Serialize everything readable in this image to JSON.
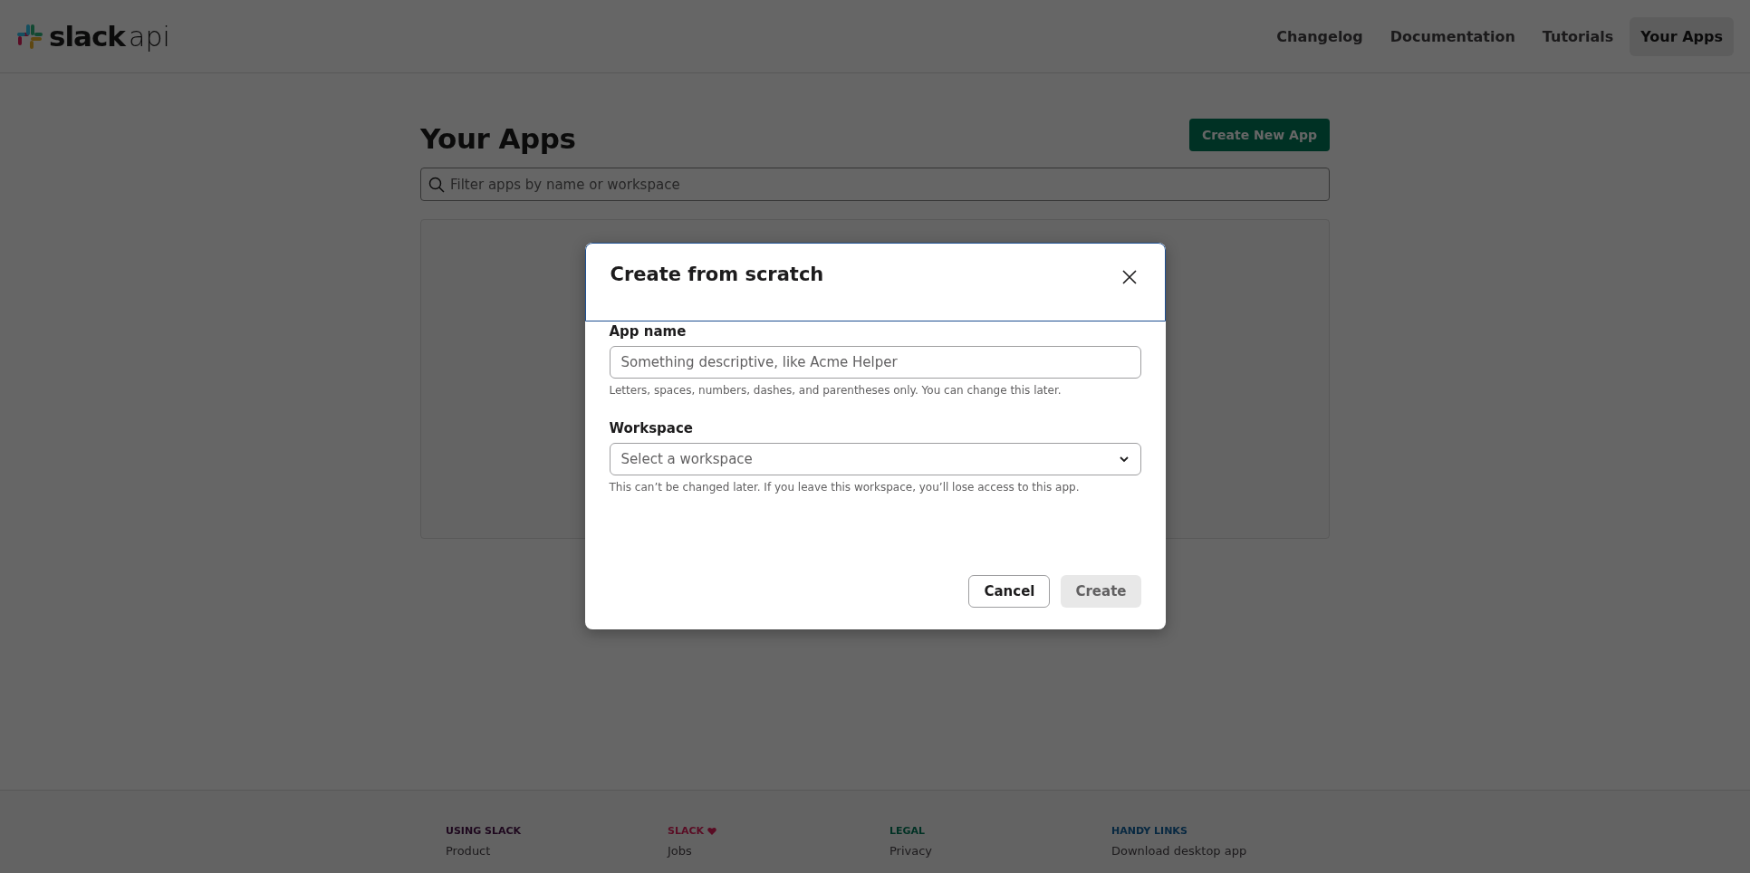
{
  "header": {
    "logo": {
      "word": "slack",
      "suffix": "api"
    },
    "nav": [
      {
        "label": "Changelog",
        "selected": false
      },
      {
        "label": "Documentation",
        "selected": false
      },
      {
        "label": "Tutorials",
        "selected": false
      },
      {
        "label": "Your Apps",
        "selected": true
      }
    ]
  },
  "page": {
    "title": "Your Apps",
    "create_button": "Create New App",
    "search": {
      "placeholder": "Filter apps by name or workspace"
    }
  },
  "footer": {
    "columns": [
      {
        "heading": "USING SLACK",
        "color": "#1e081e",
        "heart": false,
        "links": [
          "Product"
        ]
      },
      {
        "heading": "SLACK",
        "color": "#5a0c24",
        "heart": true,
        "links": [
          "Jobs"
        ]
      },
      {
        "heading": "LEGAL",
        "color": "#003124",
        "heart": false,
        "links": [
          "Privacy"
        ]
      },
      {
        "heading": "HANDY LINKS",
        "color": "#072841",
        "heart": false,
        "links": [
          "Download desktop app"
        ]
      }
    ]
  },
  "modal": {
    "title": "Create from scratch",
    "fields": [
      {
        "kind": "text",
        "label": "App name",
        "placeholder": "Something descriptive, like Acme Helper",
        "hint": "Letters, spaces, numbers, dashes, and parentheses only. You can change this later."
      },
      {
        "kind": "select",
        "label": "Workspace",
        "placeholder": "Select a workspace",
        "hint": "This can’t be changed later. If you leave this workspace, you’ll lose access to this app."
      }
    ],
    "buttons": [
      {
        "label": "Cancel",
        "kind": "secondary",
        "disabled": false
      },
      {
        "label": "Create",
        "kind": "primary",
        "disabled": true
      }
    ]
  }
}
